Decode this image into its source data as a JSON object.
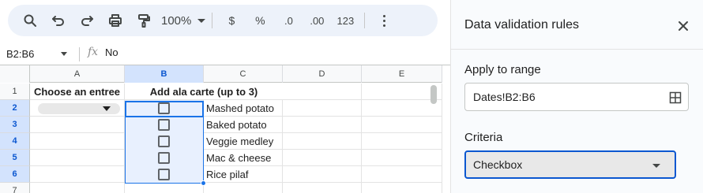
{
  "toolbar": {
    "zoom": "100%",
    "currency": "$",
    "percent": "%",
    "decrease_decimal": ".0",
    "increase_decimal": ".00",
    "number_format": "123"
  },
  "formula_bar": {
    "name_box": "B2:B6",
    "fx": "fx",
    "value": "No"
  },
  "grid": {
    "columns": [
      "A",
      "B",
      "C",
      "D",
      "E"
    ],
    "rows": [
      "1",
      "2",
      "3",
      "4",
      "5",
      "6",
      "7"
    ],
    "header_a": "Choose an entree",
    "header_b": "Add ala carte (up to 3)",
    "items": [
      "Mashed potato",
      "Baked potato",
      "Veggie medley",
      "Mac & cheese",
      "Rice pilaf"
    ]
  },
  "panel": {
    "title": "Data validation rules",
    "apply_label": "Apply to range",
    "range_value": "Dates!B2:B6",
    "criteria_label": "Criteria",
    "criteria_value": "Checkbox"
  },
  "colors": {
    "accent": "#0b57d0",
    "selection": "#1a73e8",
    "toolbar_bg": "#edf2fa"
  }
}
